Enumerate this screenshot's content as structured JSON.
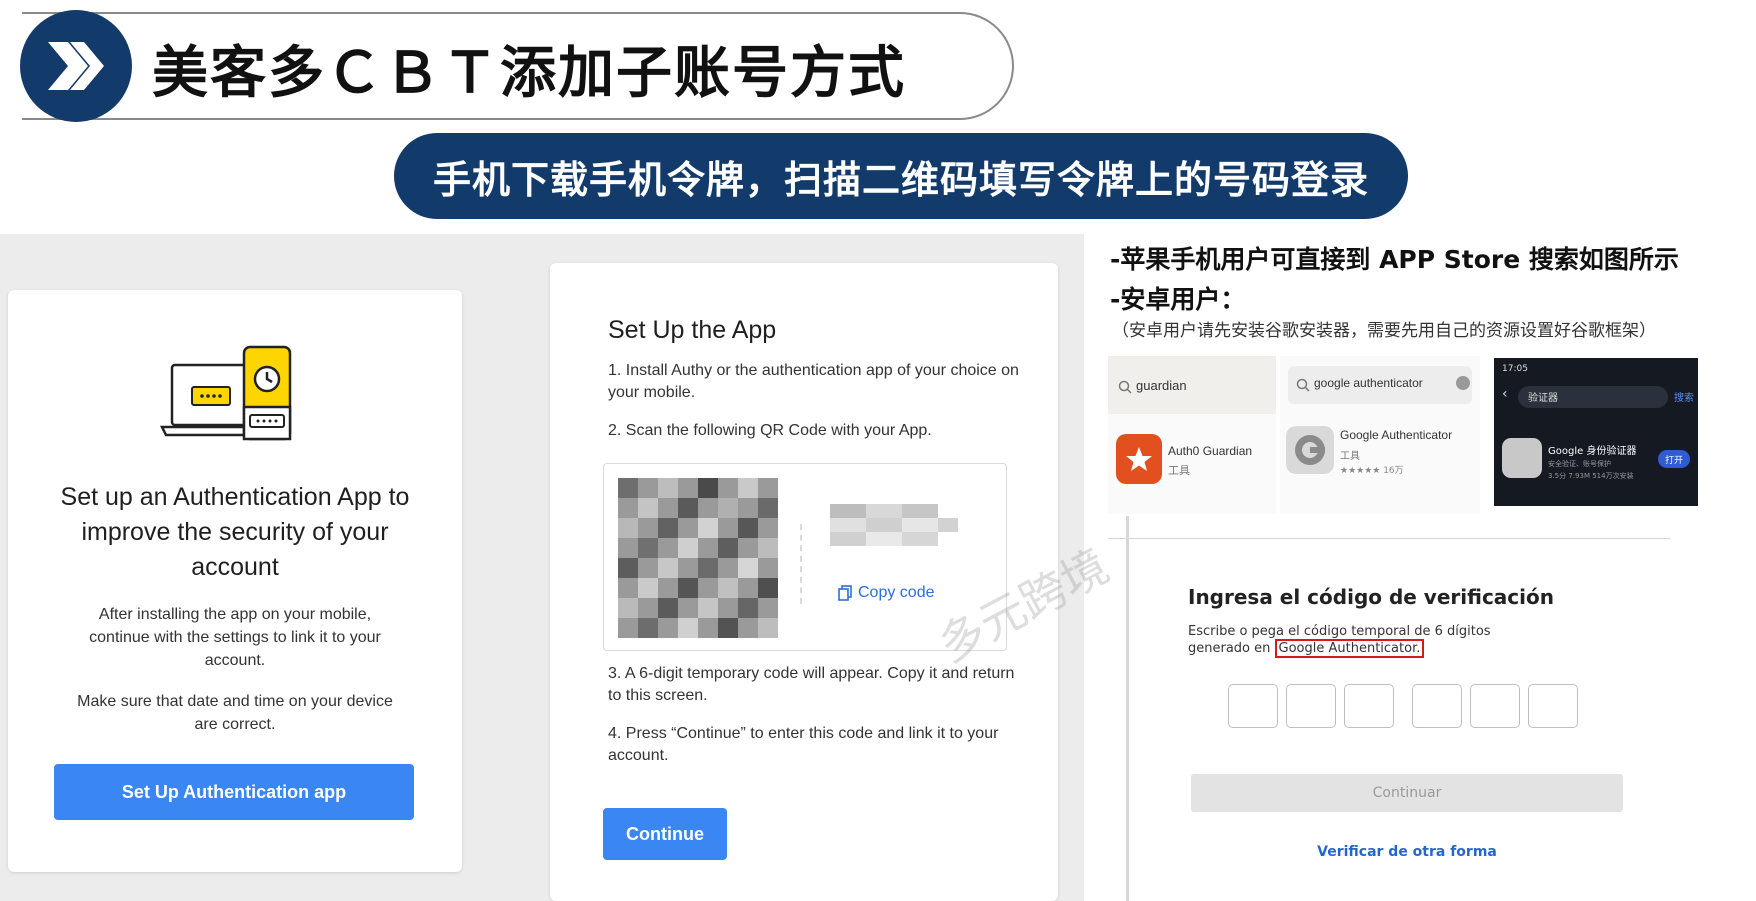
{
  "header": {
    "title": "美客多ＣＢＴ添加子账号方式",
    "subtitle": "手机下载手机令牌，扫描二维码填写令牌上的号码登录"
  },
  "card1": {
    "heading": "Set up an Authentication App to improve the security of your account",
    "body1": "After installing the app on your mobile, continue with the settings to link it to your account.",
    "body2": "Make sure that date and time on your device are correct.",
    "button": "Set Up Authentication app"
  },
  "card2": {
    "title": "Set Up the App",
    "step1": "1. Install Authy or the authentication app of your choice on your mobile.",
    "step2": "2. Scan the following QR Code with your App.",
    "step3": "3. A 6-digit temporary code will appear. Copy it and return to this screen.",
    "step4": "4. Press “Continue” to enter this code and link it to your account.",
    "copy_code": "Copy code",
    "button": "Continue"
  },
  "instructions": {
    "line1": "-苹果手机用户可直接到 APP Store 搜索如图所示",
    "line2": "-安卓用户：",
    "line3": "（安卓用户请先安装谷歌安装器，需要先用自己的资源设置好谷歌框架）"
  },
  "app_search": {
    "query1": "guardian",
    "result1": "Auth0 Guardian",
    "result1_cat": "工具",
    "query2": "google authenticator",
    "result2": "Google Authenticator",
    "result2_cat": "工具",
    "result2_rating": "★★★★★ 16万",
    "phone_time": "17:05",
    "phone_query": "验证器",
    "phone_search_btn": "搜索",
    "phone_result": "Google 身份验证器",
    "phone_result_sub": "安全验证、账号保护",
    "phone_result_meta": "3.5分 7.93M 514万次安装",
    "phone_open": "打开"
  },
  "verification": {
    "title": "Ingresa el código de verificación",
    "sub_line1": "Escribe o pega el código temporal de 6 dígitos",
    "sub_line2_prefix": "generado en ",
    "sub_line2_highlight": "Google Authenticator.",
    "button": "Continuar",
    "link": "Verificar de otra forma"
  },
  "watermark": "多元跨境",
  "colors": {
    "navy": "#123a6a",
    "primary_blue": "#3a86f2",
    "highlight_red": "#d51a1a",
    "auth_yellow": "#ffd500"
  }
}
